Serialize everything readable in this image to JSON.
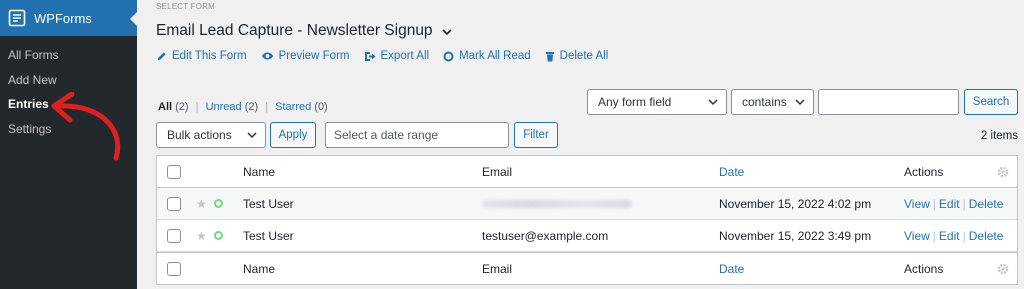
{
  "sidebar": {
    "title": "WPForms",
    "items": [
      {
        "label": "All Forms",
        "active": false
      },
      {
        "label": "Add New",
        "active": false
      },
      {
        "label": "Entries",
        "active": true
      },
      {
        "label": "Settings",
        "active": false
      }
    ]
  },
  "header": {
    "select_form_label": "SELECT FORM",
    "form_title": "Email Lead Capture - Newsletter Signup",
    "actions": [
      {
        "label": "Edit This Form",
        "icon": "pencil-icon"
      },
      {
        "label": "Preview Form",
        "icon": "eye-icon"
      },
      {
        "label": "Export All",
        "icon": "export-icon"
      },
      {
        "label": "Mark All Read",
        "icon": "circle-icon"
      },
      {
        "label": "Delete All",
        "icon": "trash-icon"
      }
    ]
  },
  "views": {
    "all_label": "All",
    "all_count": "(2)",
    "unread_label": "Unread",
    "unread_count": "(2)",
    "starred_label": "Starred",
    "starred_count": "(0)",
    "sep": "|"
  },
  "filters": {
    "field_select": "Any form field",
    "operator_select": "contains",
    "search_value": "",
    "search_button": "Search",
    "bulk_select": "Bulk actions",
    "apply_button": "Apply",
    "date_placeholder": "Select a date range",
    "filter_button": "Filter",
    "items_count": "2 items"
  },
  "table": {
    "columns": {
      "name": "Name",
      "email": "Email",
      "date": "Date",
      "actions": "Actions"
    },
    "rows": [
      {
        "name": "Test User",
        "email": "",
        "email_blurred": true,
        "date": "November 15, 2022 4:02 pm"
      },
      {
        "name": "Test User",
        "email": "testuser@example.com",
        "email_blurred": false,
        "date": "November 15, 2022 3:49 pm"
      }
    ],
    "row_actions": {
      "view": "View",
      "edit": "Edit",
      "delete": "Delete",
      "sep": "|"
    }
  },
  "colors": {
    "accent": "#2271b1",
    "sidebar_bg": "#23282d",
    "annotation_arrow": "#e02020",
    "unread_dot": "#68de7c"
  }
}
